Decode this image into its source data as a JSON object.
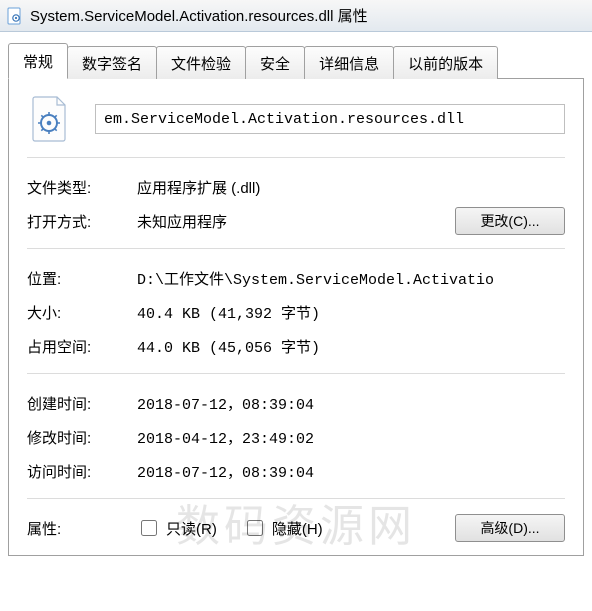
{
  "window": {
    "title": "System.ServiceModel.Activation.resources.dll 属性"
  },
  "tabs": {
    "general": "常规",
    "digital_signatures": "数字签名",
    "file_check": "文件检验",
    "security": "安全",
    "details": "详细信息",
    "previous_versions": "以前的版本"
  },
  "general": {
    "filename": "em.ServiceModel.Activation.resources.dll",
    "labels": {
      "file_type": "文件类型:",
      "opens_with": "打开方式:",
      "location": "位置:",
      "size": "大小:",
      "size_on_disk": "占用空间:",
      "created": "创建时间:",
      "modified": "修改时间:",
      "accessed": "访问时间:",
      "attributes": "属性:"
    },
    "values": {
      "file_type": "应用程序扩展 (.dll)",
      "opens_with": "未知应用程序",
      "location": "D:\\工作文件\\System.ServiceModel.Activatio",
      "size": "40.4 KB (41,392 字节)",
      "size_on_disk": "44.0 KB (45,056 字节)",
      "created": "2018-07-12，08:39:04",
      "modified": "2018-04-12，23:49:02",
      "accessed": "2018-07-12，08:39:04"
    },
    "buttons": {
      "change": "更改(C)...",
      "advanced": "高级(D)..."
    },
    "checkboxes": {
      "readonly": "只读(R)",
      "hidden": "隐藏(H)"
    }
  },
  "watermark": "数码资源网"
}
